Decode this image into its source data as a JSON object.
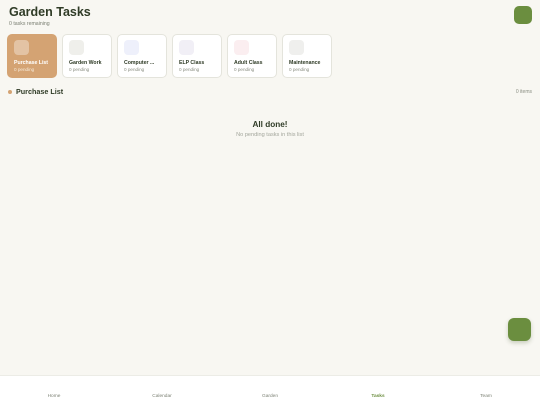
{
  "header": {
    "title": "Garden Tasks",
    "subtitle": "0 tasks remaining"
  },
  "colors": {
    "accent": "#6b8e3f",
    "active_category": "#d4a373",
    "background": "#f8f7f2"
  },
  "categories": [
    {
      "name": "Purchase List",
      "count": "0 pending",
      "active": true,
      "icon_color": "#e3bb94"
    },
    {
      "name": "Garden Work",
      "count": "0 pending",
      "active": false,
      "icon_color": "#efefeb"
    },
    {
      "name": "Computer ...",
      "count": "0 pending",
      "active": false,
      "icon_color": "#eef0fb"
    },
    {
      "name": "ELP Class",
      "count": "0 pending",
      "active": false,
      "icon_color": "#f1eff6"
    },
    {
      "name": "Adult Class",
      "count": "0 pending",
      "active": false,
      "icon_color": "#fbeef0"
    },
    {
      "name": "Maintenance",
      "count": "0 pending",
      "active": false,
      "icon_color": "#efefed"
    }
  ],
  "section": {
    "title": "Purchase List",
    "count": "0 items"
  },
  "empty_state": {
    "title": "All done!",
    "message": "No pending tasks in this list"
  },
  "nav": [
    {
      "label": "Home",
      "active": false
    },
    {
      "label": "Calendar",
      "active": false
    },
    {
      "label": "Garden",
      "active": false
    },
    {
      "label": "Tasks",
      "active": true
    },
    {
      "label": "Team",
      "active": false
    }
  ]
}
